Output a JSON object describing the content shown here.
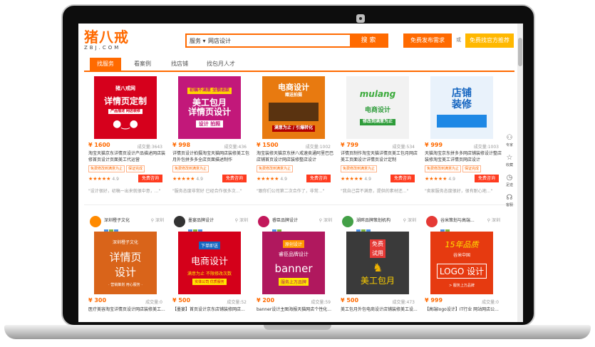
{
  "header": {
    "logo_main": "猪八戒",
    "logo_sub": "ZBJ.COM",
    "search_category": "服务 ▾",
    "search_value": "网店设计",
    "search_button": "搜 索",
    "post_button": "免费发布需求",
    "or_label": "或",
    "find_button": "免费找官方推荐"
  },
  "nav": [
    "找服务",
    "看案例",
    "找店铺",
    "找包月人才"
  ],
  "cards": [
    {
      "thumb_lines": [
        "猪八戒网",
        "详情页定制",
        "产品描述 网店装修"
      ],
      "price": "¥ 1600",
      "sales": "成交量:3643",
      "title": "淘宝天猫京东详情页设计产品描述网店装修首页设计页面美工代运营",
      "tags": [
        "免费修改到满意为止",
        "保证完成"
      ],
      "rating": "4.9",
      "consult": "免费咨询",
      "review": "\"设计很好，初稿一出来就很中意，...\""
    },
    {
      "thumb_lines": [
        "初稿不满意 全额退款",
        "美工包月",
        "详情页设计",
        "设计 拍照"
      ],
      "price": "¥ 998",
      "sales": "成交量:436",
      "title": "详情页设计拍摄淘宝天猫网店装修美工包月外包拼多多全店页面描述制作",
      "tags": [
        "免费修改到满意为止"
      ],
      "rating": "4.9",
      "consult": "免费咨询",
      "review": "\"服务态度非常好 已经合作很多次...\""
    },
    {
      "thumb_lines": [
        "电商设计",
        "赠送拍摄",
        "满意为止 / 引爆转化"
      ],
      "price": "¥ 1500",
      "sales": "成交量:1002",
      "title": "淘宝装修天猫京东拼八戒速卖通阿里巴巴店铺首页设计网店装修整店设计",
      "tags": [
        "免费修改到满意为止"
      ],
      "rating": "4.9",
      "consult": "免费咨询",
      "review": "\"跟你们公司第二次合作了，非常...\""
    },
    {
      "thumb_lines": [
        "mulang",
        "电商设计",
        "修改到满意为止"
      ],
      "price": "¥ 799",
      "sales": "成交量:534",
      "title": "详情页制作淘宝天猫详情页美工包月网店美工页面设计详情页设计定制",
      "tags": [
        "免费修改到满意为止"
      ],
      "rating": "4.9",
      "consult": "免费咨询",
      "review": "\"我自己尝不满意，提供的素材还...\""
    },
    {
      "thumb_lines": [
        "店铺",
        "装修"
      ],
      "price": "¥ 999",
      "sales": "成交量:1003",
      "title": "天猫淘宝京东拼多多网店铺装修设计整店装修淘宝美工详情页网店设计",
      "tags": [
        "免费修改到满意为止",
        "保证完成"
      ],
      "rating": "4.9",
      "consult": "免费咨询",
      "review": "\"卖家服务态度很好，很有耐心地...\""
    }
  ],
  "shops": [
    {
      "name": "深圳橙子文化",
      "location": "深圳",
      "thumb_lines": [
        "深圳橙子文化",
        "详情页",
        "设计",
        "· 营销策划 用心服务 ·"
      ],
      "price": "¥ 300",
      "sales": "成交量:0",
      "title": "医疗美容淘宝详情页设计网店装修美工..."
    },
    {
      "name": "墨宴品牌设计",
      "location": "深圳",
      "thumb_lines": [
        "下单即送",
        "电商设计",
        "满意为止 不限修改次数",
        "实体公司 优质服务"
      ],
      "price": "¥ 500",
      "sales": "成交量:52",
      "title": "【墨宴】首页设计京东店铺装修网店..."
    },
    {
      "name": "睿臣品牌设计",
      "location": "深圳",
      "thumb_lines": [
        "原创设计",
        "睿臣品牌设计",
        "banner",
        "服务上万品牌"
      ],
      "price": "¥ 200",
      "sales": "成交量:59",
      "title": "banner设计主图海报天猫网店个性化..."
    },
    {
      "name": "湖畔品牌策划机构",
      "location": "深圳",
      "thumb_lines": [
        "免费",
        "试用",
        "美工包月"
      ],
      "price": "¥ 500",
      "sales": "成交量:473",
      "title": "美工包月外包电商设计店铺装修美工设..."
    },
    {
      "name": "谷米策划与高端...",
      "location": "深圳",
      "thumb_lines": [
        "15年品质",
        "谷米中国",
        "LOGO 设计",
        "> 服务上万品牌"
      ],
      "price": "¥ 999",
      "sales": "成交量:0",
      "title": "【高端logo设计】IT行业 网站网店公..."
    }
  ],
  "side": [
    {
      "icon": "person-icon",
      "label": "专家"
    },
    {
      "icon": "star-icon",
      "label": "收藏"
    },
    {
      "icon": "clock-icon",
      "label": "足迹"
    },
    {
      "icon": "headset-icon",
      "label": "客服"
    }
  ],
  "colors": {
    "brand": "#ff6a00",
    "find": "#ffb800",
    "consult": "#ff3b1f"
  }
}
